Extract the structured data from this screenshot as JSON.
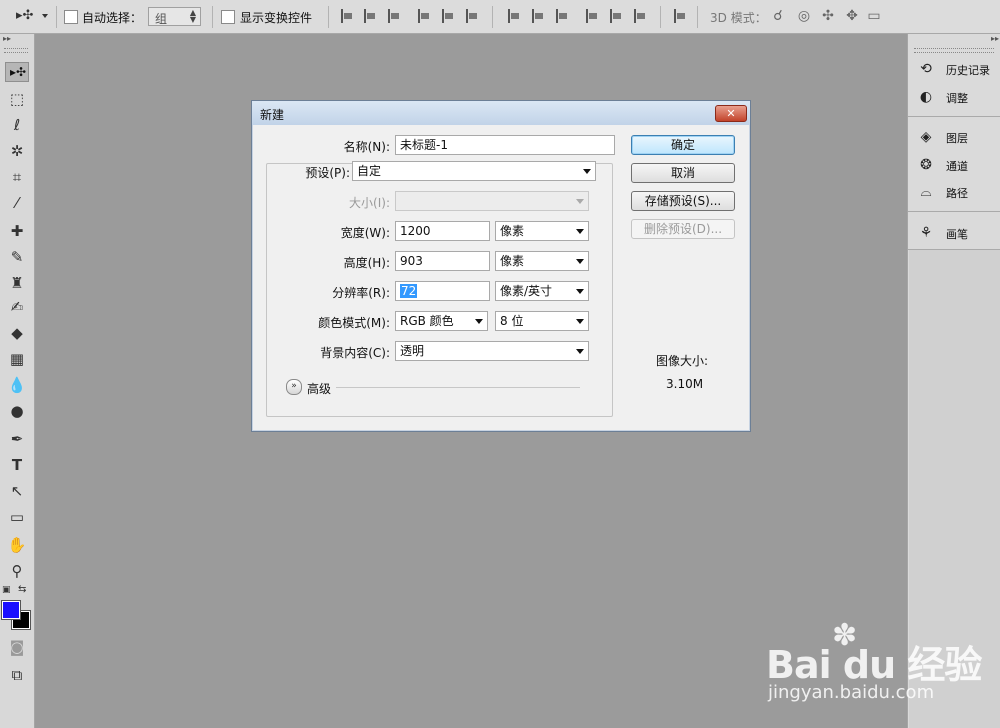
{
  "options_bar": {
    "auto_select_label": "自动选择：",
    "auto_select_value": "组",
    "show_transform_label": "显示变换控件",
    "mode_3d_label": "3D 模式："
  },
  "right_panels": [
    {
      "label": "历史记录",
      "icon": "history-icon"
    },
    {
      "label": "调整",
      "icon": "adjustments-icon"
    },
    {
      "label": "图层",
      "icon": "layers-icon"
    },
    {
      "label": "通道",
      "icon": "channels-icon"
    },
    {
      "label": "路径",
      "icon": "paths-icon"
    },
    {
      "label": "画笔",
      "icon": "brush-panel-icon"
    }
  ],
  "tools": [
    "move",
    "marquee",
    "lasso",
    "magic-wand",
    "crop",
    "eyedropper",
    "healing",
    "brush",
    "stamp",
    "history-brush",
    "eraser",
    "gradient",
    "blur",
    "dodge",
    "pen",
    "type",
    "path-select",
    "shape",
    "hand",
    "zoom"
  ],
  "colors": {
    "foreground": "#1a10ff",
    "background": "#000000"
  },
  "dialog": {
    "title": "新建",
    "name_label": "名称(N):",
    "name_value": "未标题-1",
    "preset_label": "预设(P):",
    "preset_value": "自定",
    "size_label": "大小(I):",
    "width_label": "宽度(W):",
    "width_value": "1200",
    "width_unit": "像素",
    "height_label": "高度(H):",
    "height_value": "903",
    "height_unit": "像素",
    "resolution_label": "分辨率(R):",
    "resolution_value": "72",
    "resolution_unit": "像素/英寸",
    "color_mode_label": "颜色模式(M):",
    "color_mode_value": "RGB 颜色",
    "bit_depth_value": "8 位",
    "background_label": "背景内容(C):",
    "background_value": "透明",
    "advanced_label": "高级",
    "ok_button": "确定",
    "cancel_button": "取消",
    "save_preset_button": "存储预设(S)...",
    "delete_preset_button": "删除预设(D)...",
    "image_size_label": "图像大小:",
    "image_size_value": "3.10M"
  },
  "watermark": {
    "logo": "Bai du 经验",
    "url": "jingyan.baidu.com"
  }
}
